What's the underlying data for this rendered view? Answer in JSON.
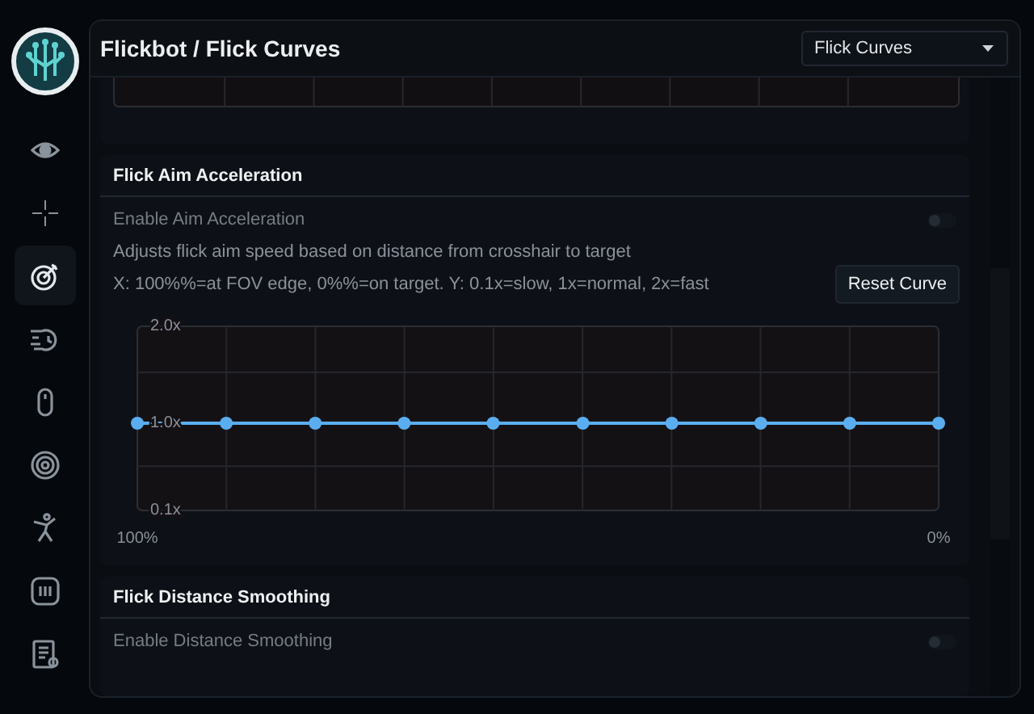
{
  "header": {
    "title": "Flickbot / Flick Curves",
    "dropdown": {
      "value": "Flick Curves"
    }
  },
  "sidebar": {
    "items": [
      {
        "selected": false
      },
      {
        "selected": false
      },
      {
        "selected": true
      },
      {
        "selected": false
      },
      {
        "selected": false
      },
      {
        "selected": false
      },
      {
        "selected": false
      },
      {
        "selected": false
      },
      {
        "selected": false
      }
    ]
  },
  "sections": [
    {
      "title": "Flick Aim Acceleration",
      "toggle": {
        "label": "Enable Aim Acceleration",
        "on": false
      },
      "description": [
        "Adjusts flick aim speed based on distance from crosshair to target",
        "X: 100%%=at FOV edge, 0%%=on target. Y: 0.1x=slow, 1x=normal, 2x=fast"
      ],
      "button": "Reset Curve",
      "chart_data": {
        "type": "line",
        "x": [
          100,
          88.9,
          77.8,
          66.7,
          55.6,
          44.4,
          33.3,
          22.2,
          11.1,
          0
        ],
        "series": [
          {
            "color": "#5aaef0",
            "marker": "circle",
            "values": [
              1.0,
              1.0,
              1.0,
              1.0,
              1.0,
              1.0,
              1.0,
              1.0,
              1.0,
              1.0
            ]
          }
        ],
        "xlim": [
          100,
          0
        ],
        "ylim": [
          0.1,
          2.0
        ],
        "xticks": [
          {
            "value": 100,
            "label": "100%"
          },
          {
            "value": 0,
            "label": "0%"
          }
        ],
        "yticks": [
          {
            "value": 2.0,
            "label": "2.0x"
          },
          {
            "value": 1.0,
            "label": "1.0x"
          },
          {
            "value": 0.1,
            "label": "0.1x"
          }
        ]
      }
    },
    {
      "title": "Flick Distance Smoothing",
      "toggle": {
        "label": "Enable Distance Smoothing",
        "on": false
      }
    }
  ]
}
